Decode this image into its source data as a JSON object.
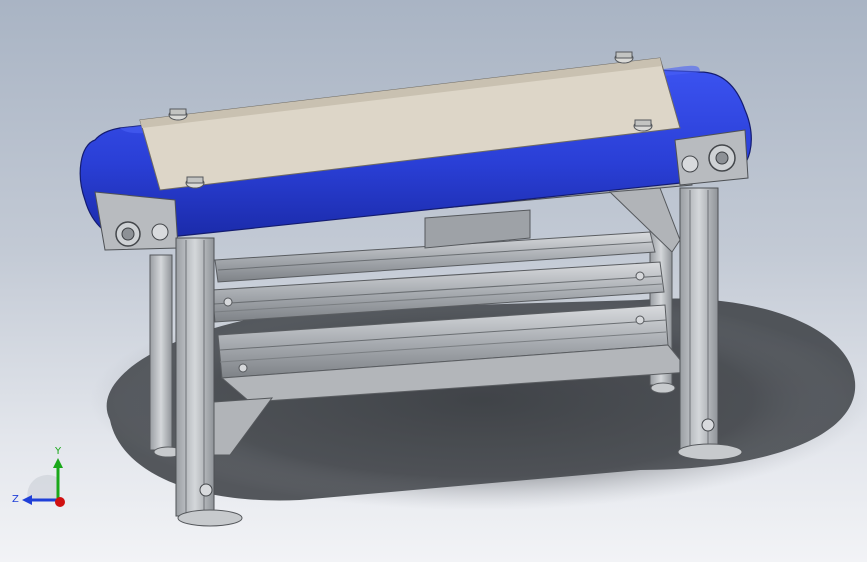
{
  "triad": {
    "y_label": "Y",
    "z_label": "Z"
  },
  "colors": {
    "belt": "#2a3fd6",
    "frame": "#b9bcc0",
    "background_top": "#a9b4c4",
    "axis_y": "#1aa81a",
    "axis_z": "#1f3fd8",
    "axis_x": "#d01010"
  }
}
